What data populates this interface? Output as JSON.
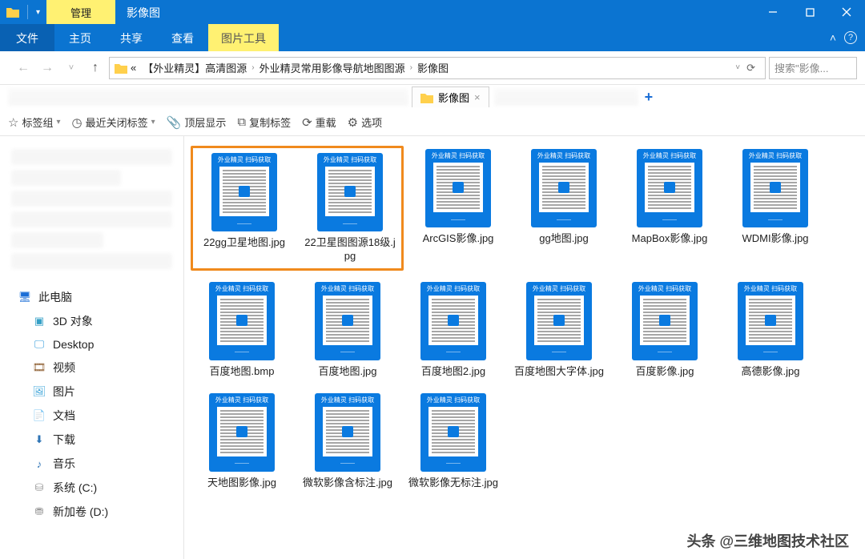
{
  "titlebar": {
    "manage": "管理",
    "title": "影像图"
  },
  "ribbon": {
    "file": "文件",
    "home": "主页",
    "share": "共享",
    "view": "查看",
    "pictools": "图片工具"
  },
  "breadcrumb": {
    "b1": "【外业精灵】高清图源",
    "b2": "外业精灵常用影像导航地图图源",
    "b3": "影像图"
  },
  "search": {
    "placeholder": "搜索\"影像..."
  },
  "tabstrip": {
    "active": "影像图"
  },
  "toolbar": {
    "tag_group": "标签组",
    "recent_closed": "最近关闭标签",
    "pin_top": "顶层显示",
    "copy_tab": "复制标签",
    "reload": "重载",
    "options": "选项"
  },
  "sidebar": {
    "thispc": "此电脑",
    "objects3d": "3D 对象",
    "desktop": "Desktop",
    "videos": "视频",
    "pictures": "图片",
    "documents": "文档",
    "downloads": "下载",
    "music": "音乐",
    "sysc": "系统 (C:)",
    "newd": "新加卷 (D:)"
  },
  "files": {
    "row1": [
      {
        "name": "22gg卫星地图.jpg"
      },
      {
        "name": "22卫星图图源18级.jpg"
      },
      {
        "name": "ArcGIS影像.jpg"
      },
      {
        "name": "gg地图.jpg"
      },
      {
        "name": "MapBox影像.jpg"
      },
      {
        "name": "WDMI影像.jpg"
      }
    ],
    "row2": [
      {
        "name": "百度地图.bmp"
      },
      {
        "name": "百度地图.jpg"
      },
      {
        "name": "百度地图2.jpg"
      },
      {
        "name": "百度地图大字体.jpg"
      },
      {
        "name": "百度影像.jpg"
      },
      {
        "name": "高德影像.jpg"
      }
    ],
    "row3": [
      {
        "name": "天地图影像.jpg"
      },
      {
        "name": "微软影像含标注.jpg"
      },
      {
        "name": "微软影像无标注.jpg"
      }
    ]
  },
  "thumb_header": "外业精灵 扫码获取",
  "attribution": "头条 @三维地图技术社区"
}
